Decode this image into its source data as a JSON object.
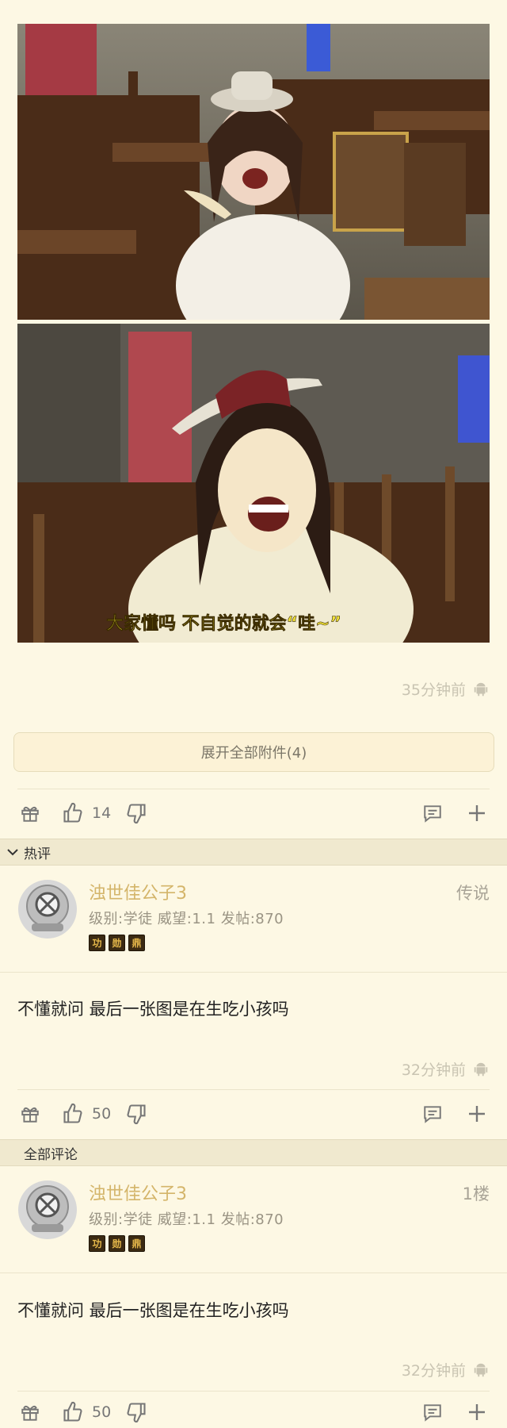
{
  "post": {
    "photos": [
      {
        "subtitle": ""
      },
      {
        "subtitle": "大家懂吗 不自觉的就会“哇~”"
      }
    ],
    "time": "35分钟前",
    "platform_icon": "android-icon",
    "expand_label": "展开全部附件(4)",
    "likes": "14"
  },
  "hot_section": {
    "label": "热评"
  },
  "all_section": {
    "label": "全部评论"
  },
  "comments": [
    {
      "username": "浊世佳公子3",
      "info": "级别:学徒 威望:1.1 发帖:870",
      "floor": "传说",
      "badges": [
        "功",
        "勋",
        "鼎"
      ],
      "text": "不懂就问 最后一张图是在生吃小孩吗",
      "time": "32分钟前",
      "likes": "50"
    },
    {
      "username": "浊世佳公子3",
      "info": "级别:学徒 威望:1.1 发帖:870",
      "floor": "1楼",
      "badges": [
        "功",
        "勋",
        "鼎"
      ],
      "text": "不懂就问 最后一张图是在生吃小孩吗",
      "time": "32分钟前",
      "likes": "50"
    }
  ],
  "colors": {
    "background": "#fdf8e4",
    "username": "#d4b56a",
    "muted": "#c9c4b2",
    "section": "#f0e9cf"
  }
}
